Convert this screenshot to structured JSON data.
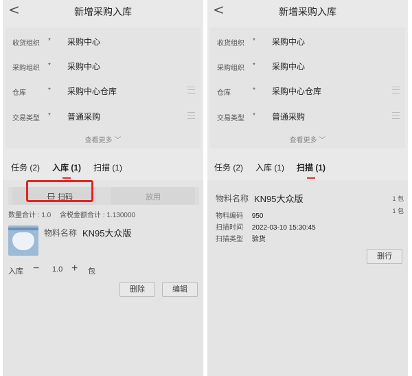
{
  "left": {
    "title": "新增采购入库",
    "back": "<",
    "form": [
      {
        "label": "收货组织",
        "required": "*",
        "value": "采购中心",
        "menu": false
      },
      {
        "label": "采购组织",
        "required": "*",
        "value": "采购中心",
        "menu": false
      },
      {
        "label": "仓库",
        "required": "*",
        "value": "采购中心仓库",
        "menu": true
      },
      {
        "label": "交易类型",
        "required": "*",
        "value": "普通采购",
        "menu": true
      }
    ],
    "more": "查看更多 ﹀",
    "tabs": [
      "任务 (2)",
      "入库 (1)",
      "扫描 (1)"
    ],
    "active_tab": 1,
    "scan_label": "扫码",
    "discard_label": "放用",
    "summary": {
      "qty": "数量合计 : 1.0",
      "amount": "含税金额合计 : 1.130000"
    },
    "material_label": "物料名称",
    "material_value": "KN95大众版",
    "qty_label": "入库",
    "minus": "−",
    "qty_value": "1.0",
    "plus": "+",
    "unit": "包",
    "delete_label": "删除",
    "edit_label": "编辑"
  },
  "right": {
    "title": "新增采购入库",
    "back": "<",
    "form": [
      {
        "label": "收货组织",
        "required": "*",
        "value": "采购中心",
        "menu": false
      },
      {
        "label": "采购组织",
        "required": "*",
        "value": "采购中心",
        "menu": false
      },
      {
        "label": "仓库",
        "required": "*",
        "value": "采购中心仓库",
        "menu": true
      },
      {
        "label": "交易类型",
        "required": "*",
        "value": "普通采购",
        "menu": true
      }
    ],
    "more": "查看更多 ﹀",
    "tabs": [
      "任务 (2)",
      "入库 (1)",
      "扫描 (1)"
    ],
    "active_tab": 2,
    "material_label": "物料名称",
    "material_value": "KN95大众版",
    "side_num_1": "1 包",
    "side_num_2": "1 包",
    "code_label": "物料编码",
    "code_value": "950",
    "time_label": "扫描时间",
    "time_value": "2022-03-10 15:30:45",
    "type_label": "扫描类型",
    "type_value": "验货",
    "delete_row_label": "删行"
  },
  "colors": {
    "accent_red": "#e03030",
    "highlight_box": "#e02424"
  }
}
